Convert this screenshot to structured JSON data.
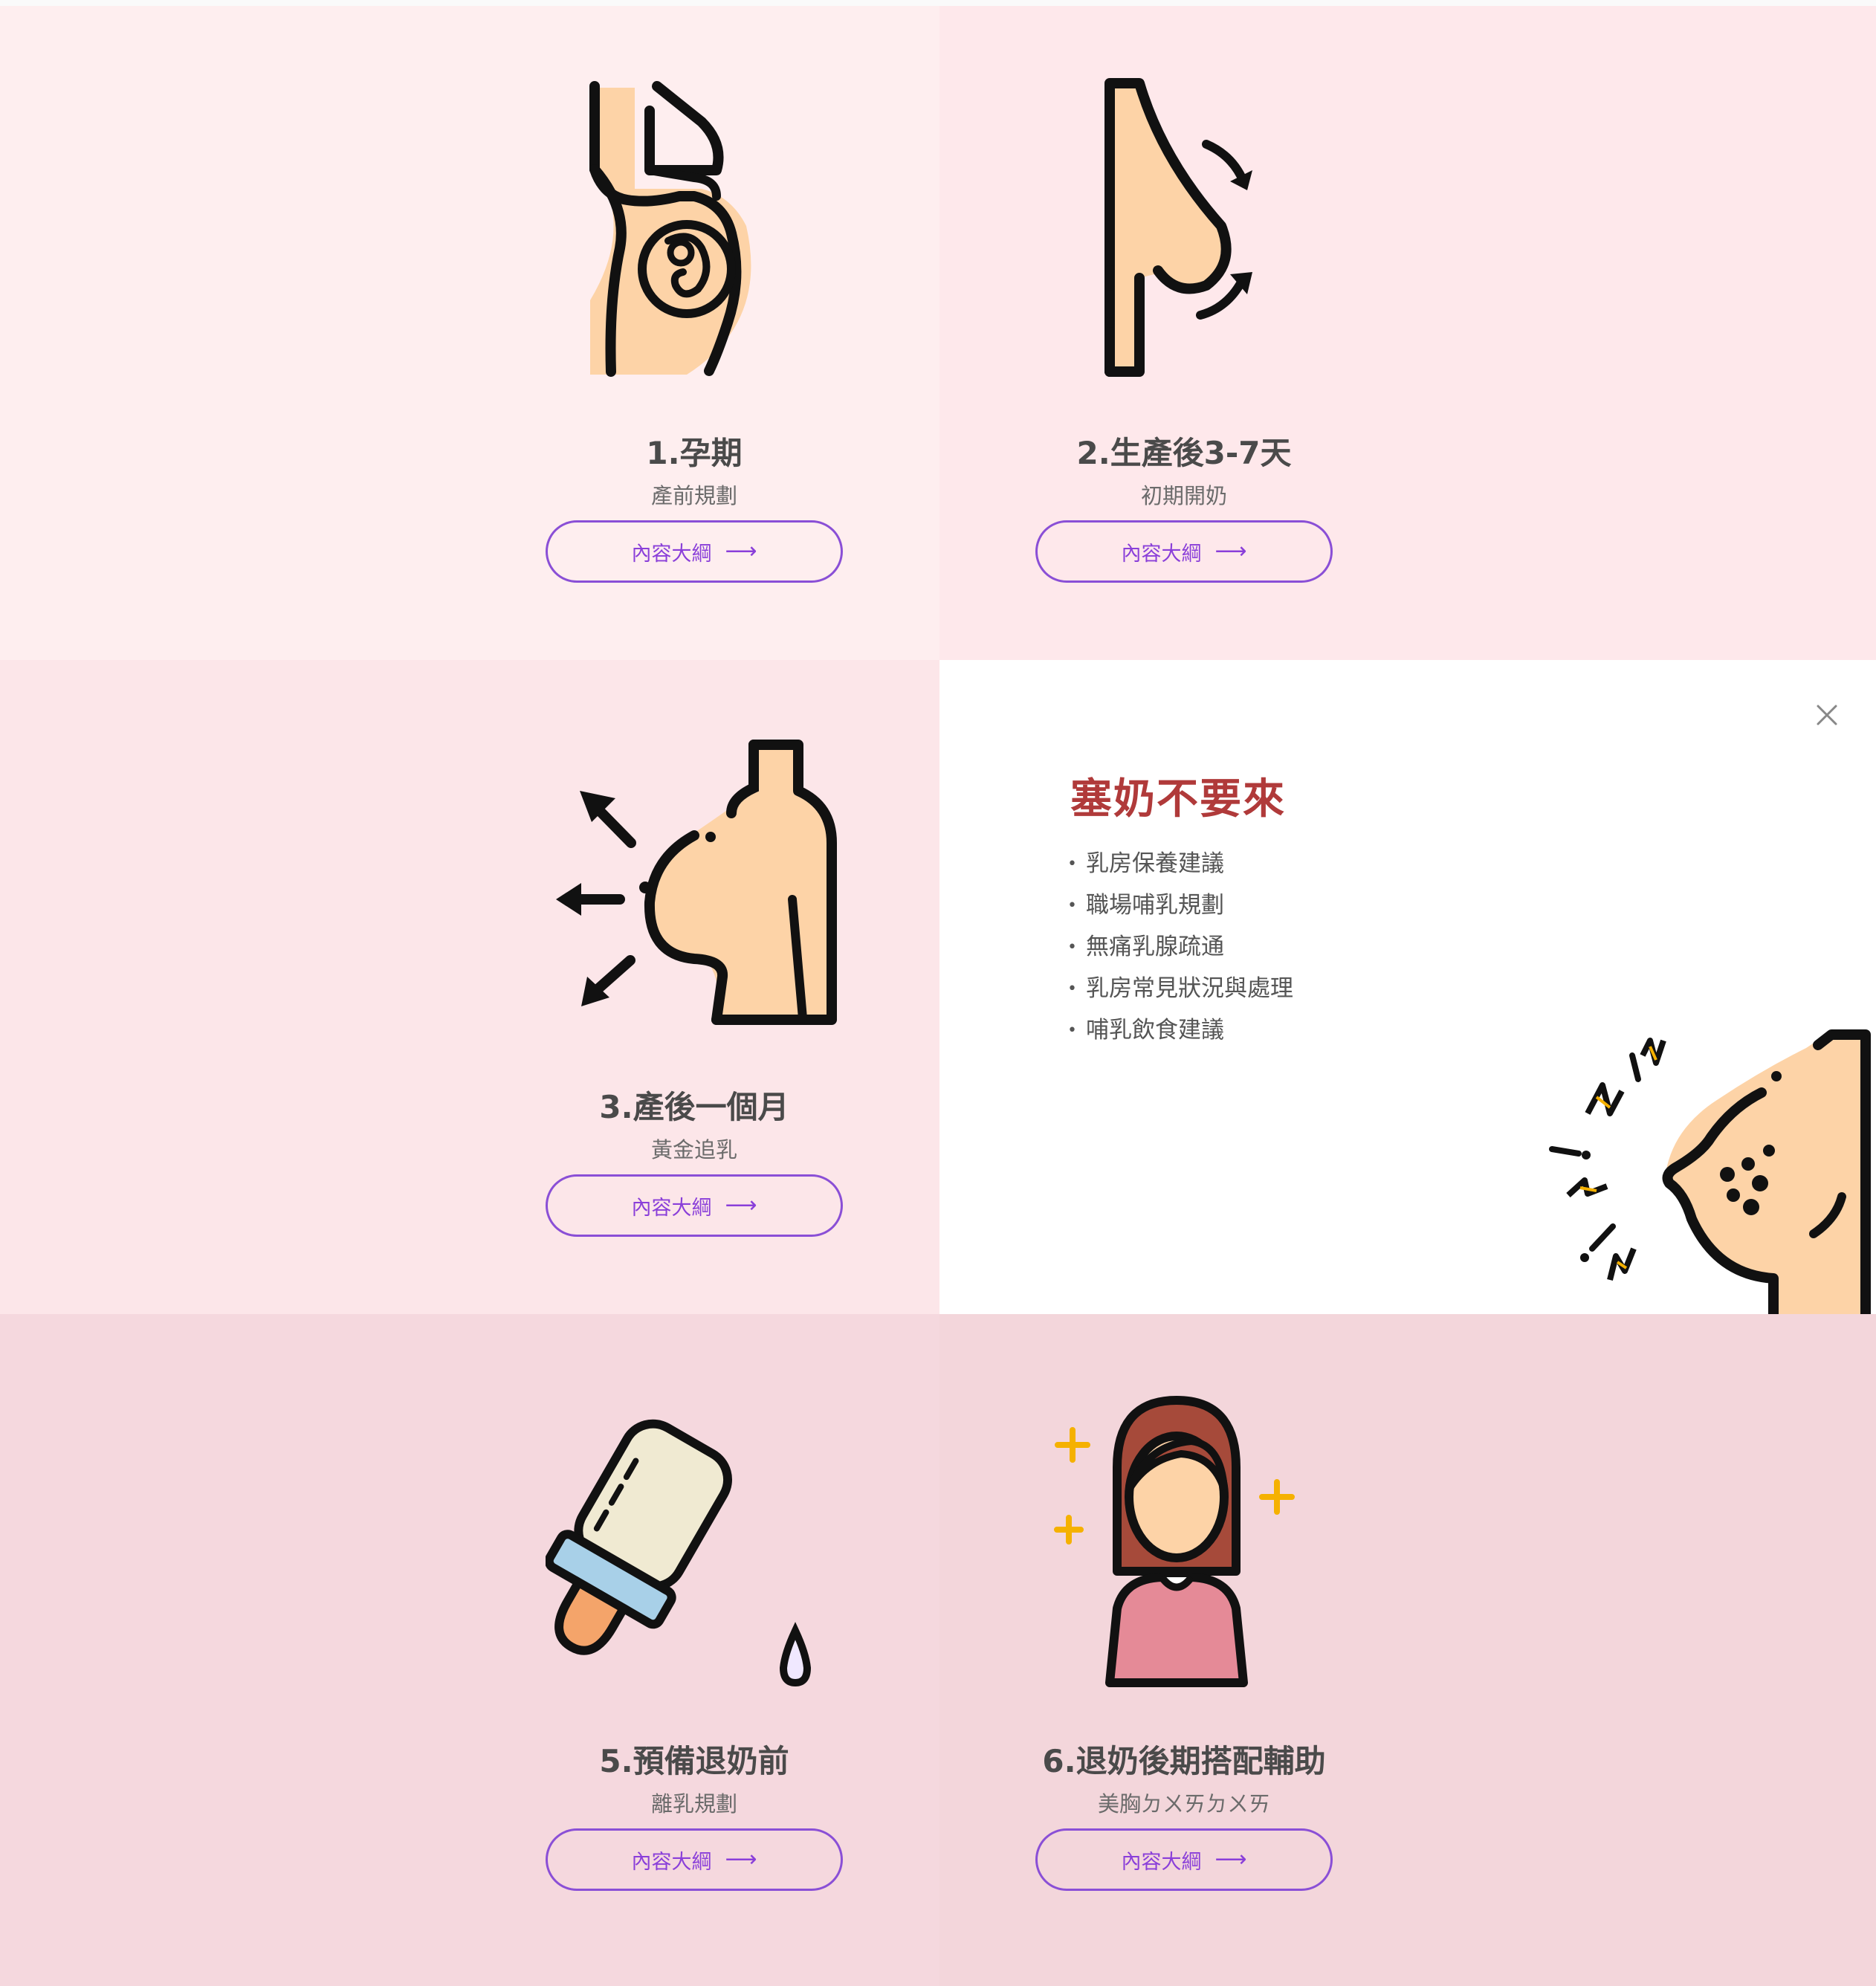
{
  "cards": [
    {
      "title": "1.孕期",
      "subtitle": "產前規劃",
      "button": "內容大綱"
    },
    {
      "title": "2.生產後3-7天",
      "subtitle": "初期開奶",
      "button": "內容大綱"
    },
    {
      "title": "3.產後一個月",
      "subtitle": "黃金追乳",
      "button": "內容大綱"
    },
    {
      "title": "5.預備退奶前",
      "subtitle": "離乳規劃",
      "button": "內容大綱"
    },
    {
      "title": "6.退奶後期搭配輔助",
      "subtitle": "美胸ㄉㄨㄞㄉㄨㄞ",
      "button": "內容大綱"
    }
  ],
  "button_arrow": "⟶",
  "popup": {
    "title": "塞奶不要來",
    "items": [
      "乳房保養建議",
      "職場哺乳規劃",
      "無痛乳腺疏通",
      "乳房常見狀況與處理",
      "哺乳飲食建議"
    ],
    "close_icon": "close-icon"
  },
  "colors": {
    "accent": "#8a3fd9",
    "popup_title": "#b03a3a",
    "skin": "#fdd3a7",
    "outline": "#111111"
  }
}
